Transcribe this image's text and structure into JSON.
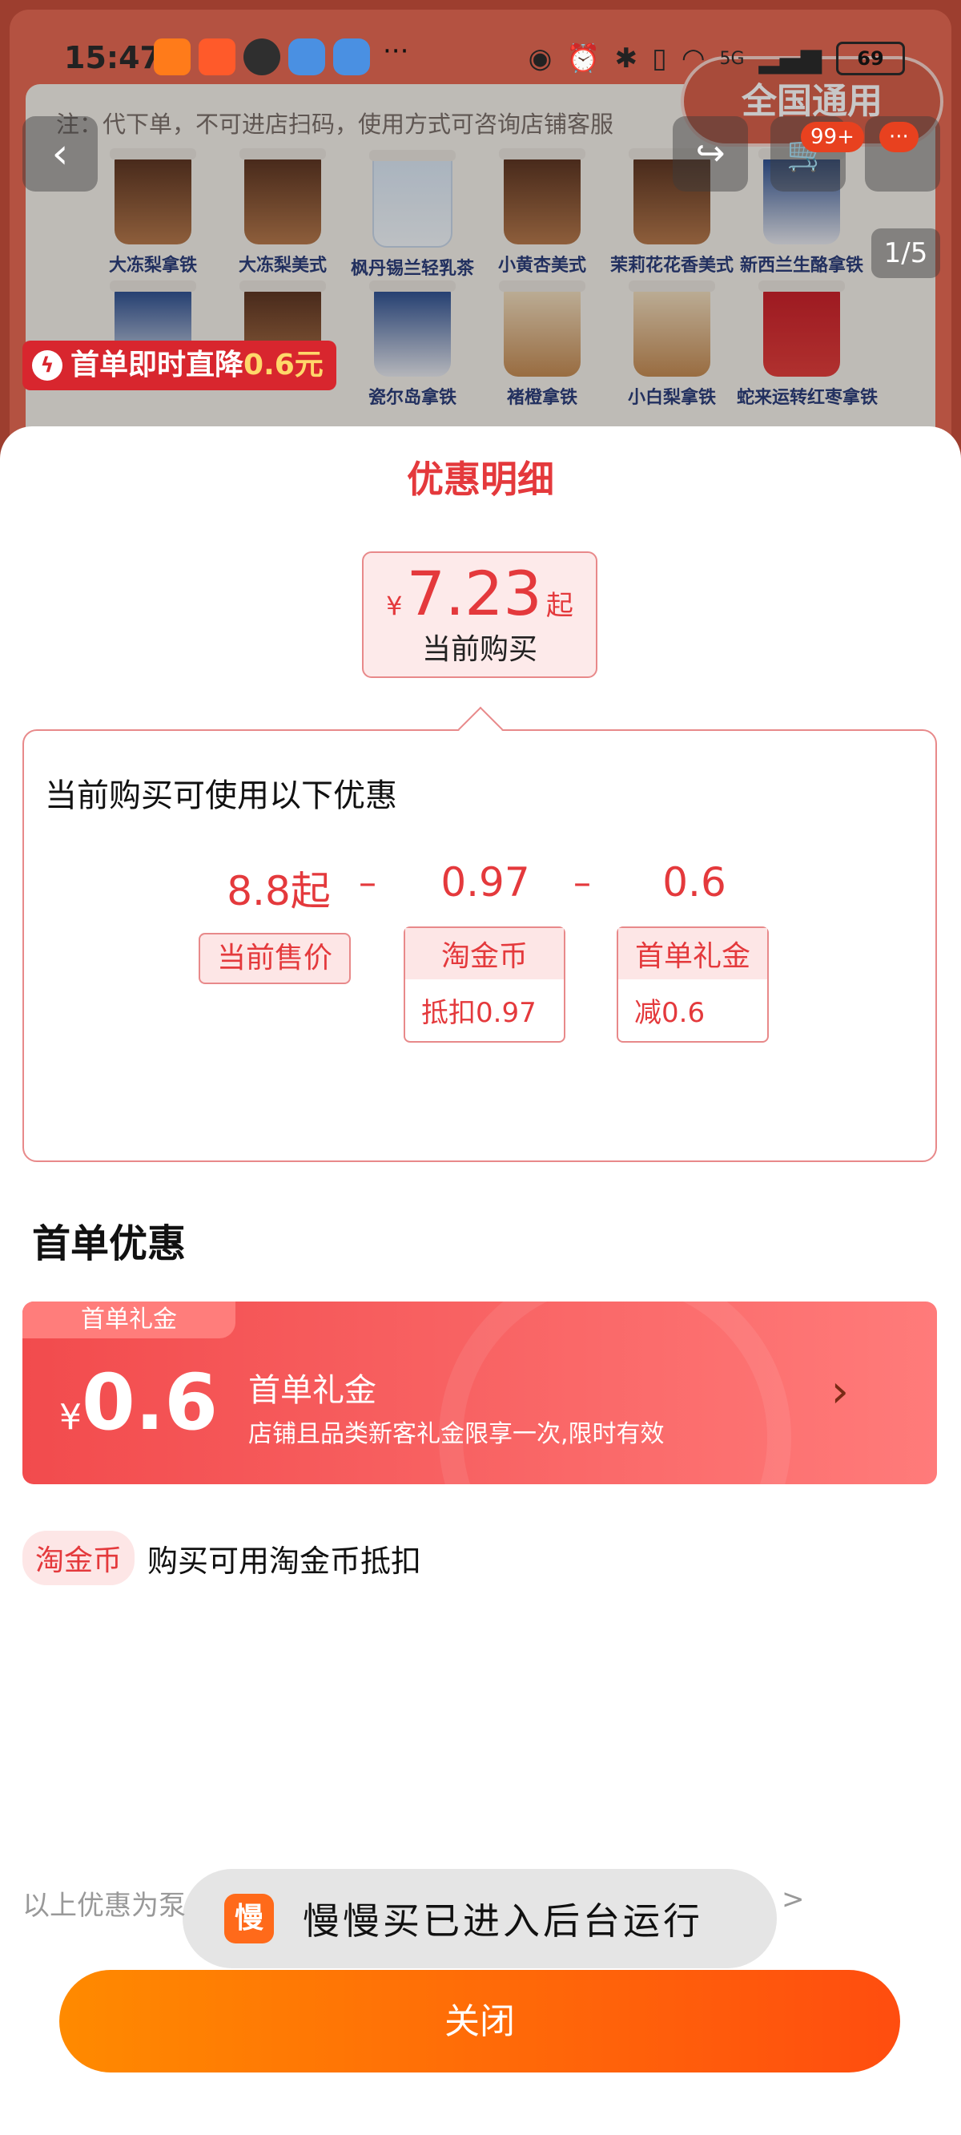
{
  "status_bar": {
    "time": "15:47",
    "battery": "69",
    "network": "5G",
    "more": "···"
  },
  "background": {
    "note": "注：代下单，不可进店扫码，使用方式可咨询店铺客服",
    "whole_country": "全国通用",
    "cart_badge": "99+",
    "more_badge": "···",
    "pager": "1/5",
    "first_order_tag_prefix": "首单即时直降",
    "first_order_tag_amount": "0.6元",
    "drinks_row1": [
      "大冻梨拿铁",
      "大冻梨美式",
      "枫丹锡兰轻乳茶",
      "小黄杏美式",
      "茉莉花花香美式",
      "新西兰生酪拿铁"
    ],
    "drinks_row2": [
      "",
      "",
      "瓷尔岛拿铁",
      "褚橙拿铁",
      "小白梨拿铁",
      "蛇来运转红枣拿铁"
    ]
  },
  "sheet": {
    "title": "优惠明细",
    "price": {
      "currency": "¥",
      "value": "7.23",
      "suffix": "起",
      "label": "当前购买"
    },
    "breakdown": {
      "heading": "当前购买可使用以下优惠",
      "minus": "–",
      "items": [
        {
          "value": "8.8起",
          "label": "当前售价"
        },
        {
          "value": "0.97",
          "label": "淘金币",
          "detail": "抵扣0.97"
        },
        {
          "value": "0.6",
          "label": "首单礼金",
          "detail": "减0.6"
        }
      ]
    },
    "section_title": "首单优惠",
    "coupon": {
      "tab": "首单礼金",
      "currency": "¥",
      "amount": "0.6",
      "name": "首单礼金",
      "desc": "店铺且品类新客礼金限享一次,限时有效"
    },
    "coin": {
      "chip": "淘金币",
      "text": "购买可用淘金币抵扣"
    },
    "footnote": "以上优惠为泵",
    "footnote_arrow": ">",
    "toast": {
      "logo": "慢",
      "message": "慢慢买已进入后台运行"
    },
    "close": "关闭"
  },
  "colors": {
    "accent": "#e4393c",
    "close_start": "#ff8a00",
    "close_end": "#ff4d0f"
  }
}
